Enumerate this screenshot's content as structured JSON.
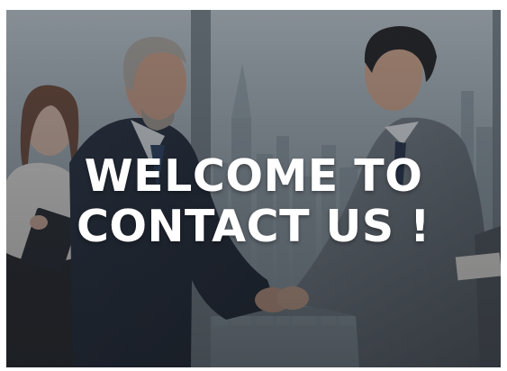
{
  "banner": {
    "headline_line1": "WELCOME TO",
    "headline_line2": "CONTACT US !"
  },
  "colors": {
    "text": "#ffffff",
    "overlay_tint": "#3a4048"
  }
}
